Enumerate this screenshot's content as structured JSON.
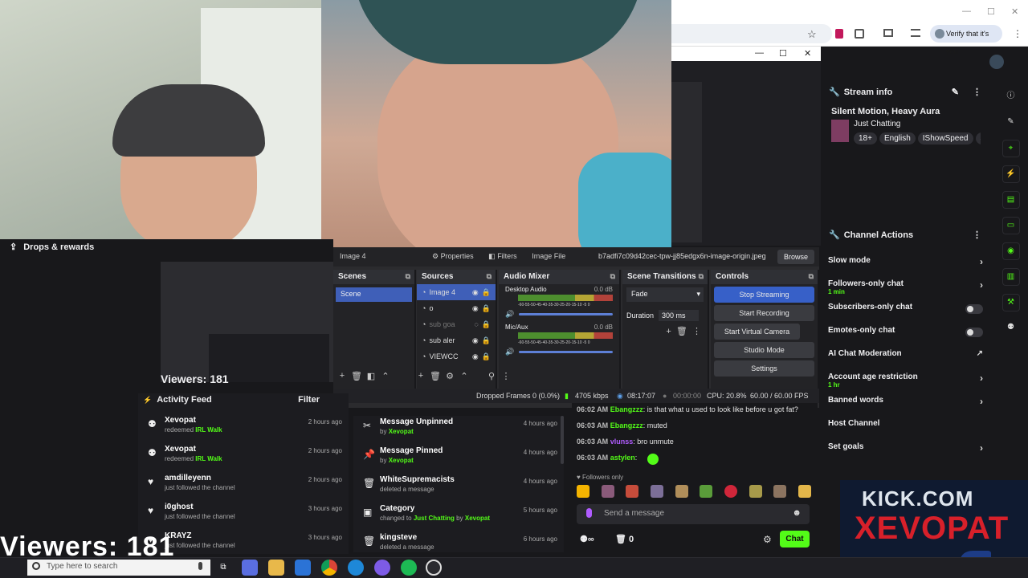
{
  "browser": {
    "verify_label": "Verify that it's you",
    "minimize": "—",
    "restore": "☐",
    "close": "✕",
    "obs_min": "—",
    "obs_max": "☐",
    "obs_close": "✕",
    "star": "☆"
  },
  "drops": {
    "label": "Drops & rewards"
  },
  "obs": {
    "file_path": "Image 4",
    "properties": "Properties",
    "filters": "Filters",
    "image_file_label": "Image File",
    "image_file_value": "b7adfi7c09d42cec-tpw-jj85edgx6n-image-origin.jpeg",
    "browse": "Browse",
    "scenes_title": "Scenes",
    "scene_name": "Scene",
    "sources_title": "Sources",
    "sources": [
      {
        "name": "Image 4",
        "hidden": false
      },
      {
        "name": "o",
        "hidden": false
      },
      {
        "name": "sub goa",
        "hidden": true
      },
      {
        "name": "sub aler",
        "hidden": false
      },
      {
        "name": "VIEWCC",
        "hidden": false
      }
    ],
    "audio_title": "Audio Mixer",
    "audio": [
      {
        "name": "Desktop Audio",
        "db": "0.0 dB"
      },
      {
        "name": "Mic/Aux",
        "db": "0.0 dB"
      }
    ],
    "meter_scale": "-60-55-50-45-40-35-30-25-20-15-10 -5 0",
    "transitions_title": "Scene Transitions",
    "transition": "Fade",
    "duration_label": "Duration",
    "duration_value": "300 ms",
    "controls_title": "Controls",
    "controls": [
      "Stop Streaming",
      "Start Recording",
      "Start Virtual Camera",
      "Studio Mode",
      "Settings"
    ],
    "status": {
      "dropped": "Dropped Frames 0 (0.0%)",
      "kbps": "4705 kbps",
      "live": "08:17:07",
      "rec": "00:00:00",
      "cpu": "CPU: 20.8%",
      "fps": "60.00 / 60.00 FPS"
    }
  },
  "overlay": {
    "viewers_small": "Viewers: 181",
    "viewers_big": "Viewers: 181"
  },
  "feed": {
    "title": "Activity Feed",
    "filter": "Filter",
    "items": [
      {
        "icon": "⚉",
        "name": "Xevopat",
        "pre": "redeemed",
        "hl": "IRL Walk",
        "time": "2 hours ago"
      },
      {
        "icon": "⚉",
        "name": "Xevopat",
        "pre": "redeemed",
        "hl": "IRL Walk",
        "time": "2 hours ago"
      },
      {
        "icon": "♥",
        "name": "amdilleyenn",
        "pre": "just followed the channel",
        "hl": "",
        "time": "2 hours ago"
      },
      {
        "icon": "♥",
        "name": "i0ghost",
        "pre": "just followed the channel",
        "hl": "",
        "time": "3 hours ago"
      },
      {
        "icon": "♥",
        "name": "KRAYZ",
        "pre": "just followed the channel",
        "hl": "",
        "time": "3 hours ago"
      }
    ]
  },
  "mod": {
    "items": [
      {
        "icon": "✂",
        "title": "Message Unpinned",
        "pre": "by",
        "hl": "Xevopat",
        "post": "",
        "hl2": "",
        "time": "4 hours ago"
      },
      {
        "icon": "📌",
        "title": "Message Pinned",
        "pre": "by",
        "hl": "Xevopat",
        "post": "",
        "hl2": "",
        "time": "4 hours ago"
      },
      {
        "icon": "🗑",
        "title": "WhiteSupremacists",
        "pre": "deleted a message",
        "hl": "",
        "post": "",
        "hl2": "",
        "time": "4 hours ago"
      },
      {
        "icon": "▣",
        "title": "Category",
        "pre": "changed to",
        "hl": "Just Chatting",
        "post": "by",
        "hl2": "Xevopat",
        "time": "5 hours ago"
      },
      {
        "icon": "🗑",
        "title": "kingsteve",
        "pre": "deleted a message",
        "hl": "",
        "post": "",
        "hl2": "",
        "time": "6 hours ago"
      }
    ]
  },
  "chat": {
    "messages": [
      {
        "time": "06:02 AM",
        "user": "Ebangzzz",
        "color": "#53fc18",
        "text": ": is that what u used to look like before u got fat?"
      },
      {
        "time": "06:03 AM",
        "user": "Ebangzzz",
        "color": "#53fc18",
        "text": ": muted"
      },
      {
        "time": "06:03 AM",
        "user": "vlunss",
        "color": "#b05cff",
        "text": ": bro unmute"
      },
      {
        "time": "06:03 AM",
        "user": "astylen",
        "color": "#53fc18",
        "text": ":"
      }
    ],
    "followers_only": "Followers only",
    "placeholder": "Send a message",
    "points": "0",
    "chat_button": "Chat",
    "infinity": "∞"
  },
  "stream_info": {
    "title": "Stream info",
    "stream_title": "Silent Motion, Heavy Aura",
    "category": "Just Chatting",
    "tags": [
      "18+",
      "English",
      "IShowSpeed",
      "a"
    ]
  },
  "channel_actions": {
    "title": "Channel Actions",
    "rows": [
      {
        "label": "Slow mode",
        "kind": "chevron",
        "sub": ""
      },
      {
        "label": "Followers-only chat",
        "kind": "chevron",
        "sub": "1 min"
      },
      {
        "label": "Subscribers-only chat",
        "kind": "toggle",
        "sub": ""
      },
      {
        "label": "Emotes-only chat",
        "kind": "toggle",
        "sub": ""
      },
      {
        "label": "AI Chat Moderation",
        "kind": "external",
        "sub": ""
      },
      {
        "label": "Account age restriction",
        "kind": "chevron",
        "sub": "1 hr"
      },
      {
        "label": "Banned words",
        "kind": "chevron",
        "sub": ""
      },
      {
        "label": "Host Channel",
        "kind": "none",
        "sub": ""
      },
      {
        "label": "Set goals",
        "kind": "chevron",
        "sub": ""
      }
    ]
  },
  "kick_logo": {
    "line1": "KICK.COM",
    "line2": "XEVOPAT"
  },
  "taskbar": {
    "search_placeholder": "Type here to search"
  }
}
